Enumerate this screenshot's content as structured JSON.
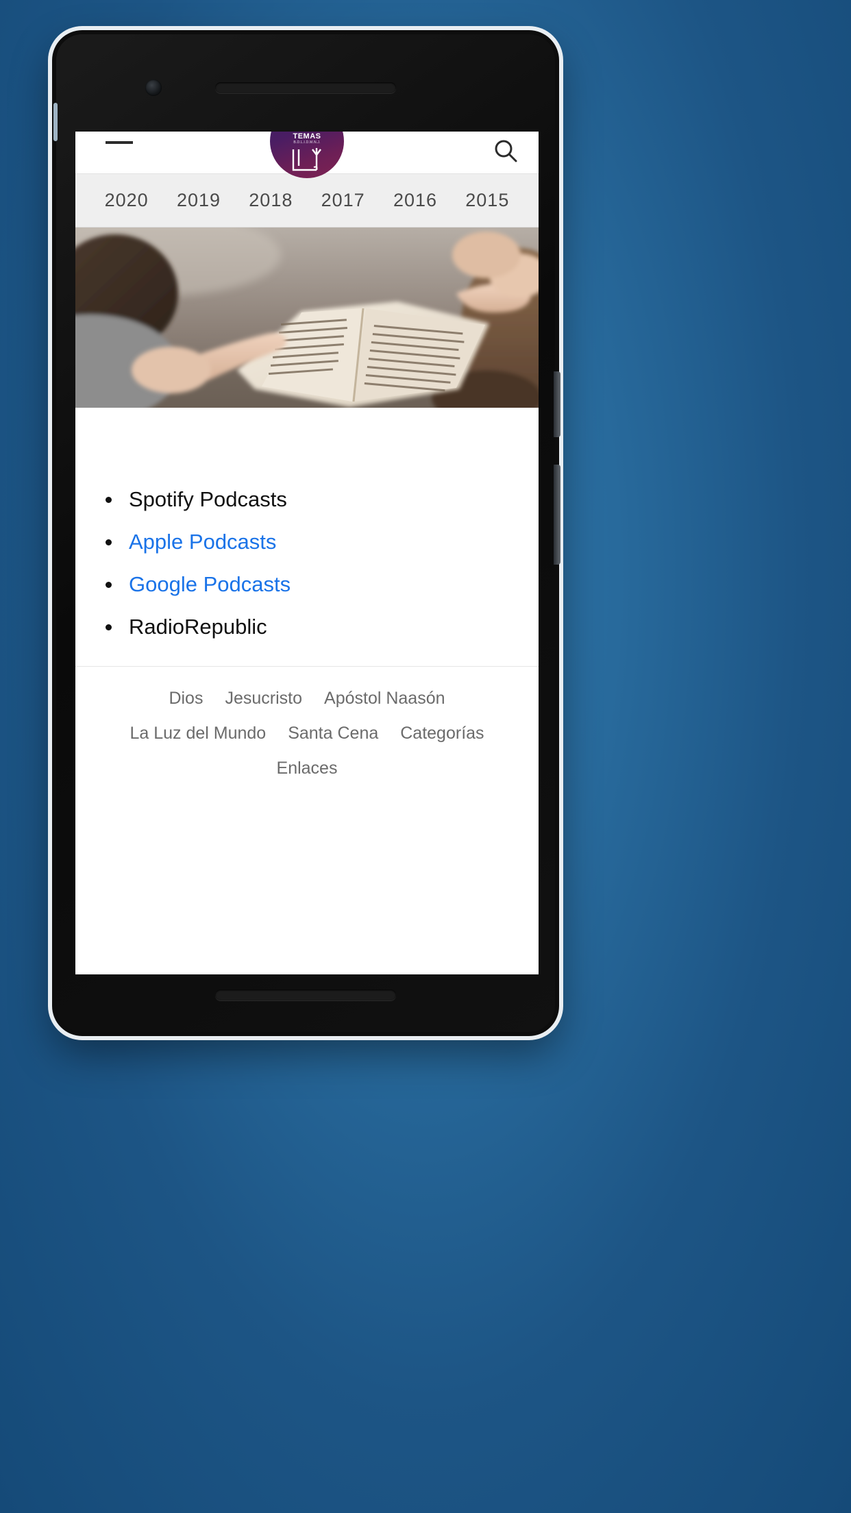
{
  "device": {
    "name": "android-phone-mockup",
    "background_color": "#1d5585"
  },
  "page": {
    "header": {
      "menu_icon": "hamburger-icon",
      "search_icon": "search-icon",
      "logo": {
        "word": "TEMAS",
        "subtitle": "B.D.L.I.D.M.N.J.",
        "mark": "open-book-icon",
        "color_start": "#3d1f62",
        "color_end": "#7e2352"
      }
    },
    "year_tabs": [
      {
        "label": "2020"
      },
      {
        "label": "2019"
      },
      {
        "label": "2018"
      },
      {
        "label": "2017"
      },
      {
        "label": "2016"
      },
      {
        "label": "2015"
      }
    ],
    "hero": {
      "alt": "two people reading an open bible on a rug"
    },
    "podcast_list": [
      {
        "label": "Spotify Podcasts",
        "is_link": false,
        "color": "#111111"
      },
      {
        "label": "Apple Podcasts",
        "is_link": true,
        "color": "#1a73e8"
      },
      {
        "label": "Google Podcasts",
        "is_link": true,
        "color": "#1a73e8"
      },
      {
        "label": "RadioRepublic",
        "is_link": false,
        "color": "#111111"
      }
    ],
    "footer": {
      "rows": [
        [
          {
            "label": "Dios"
          },
          {
            "label": "Jesucristo"
          },
          {
            "label": "Apóstol Naasón"
          }
        ],
        [
          {
            "label": "La Luz del Mundo"
          },
          {
            "label": "Santa Cena"
          },
          {
            "label": "Categorías"
          }
        ],
        [
          {
            "label": "Enlaces"
          }
        ]
      ]
    }
  }
}
